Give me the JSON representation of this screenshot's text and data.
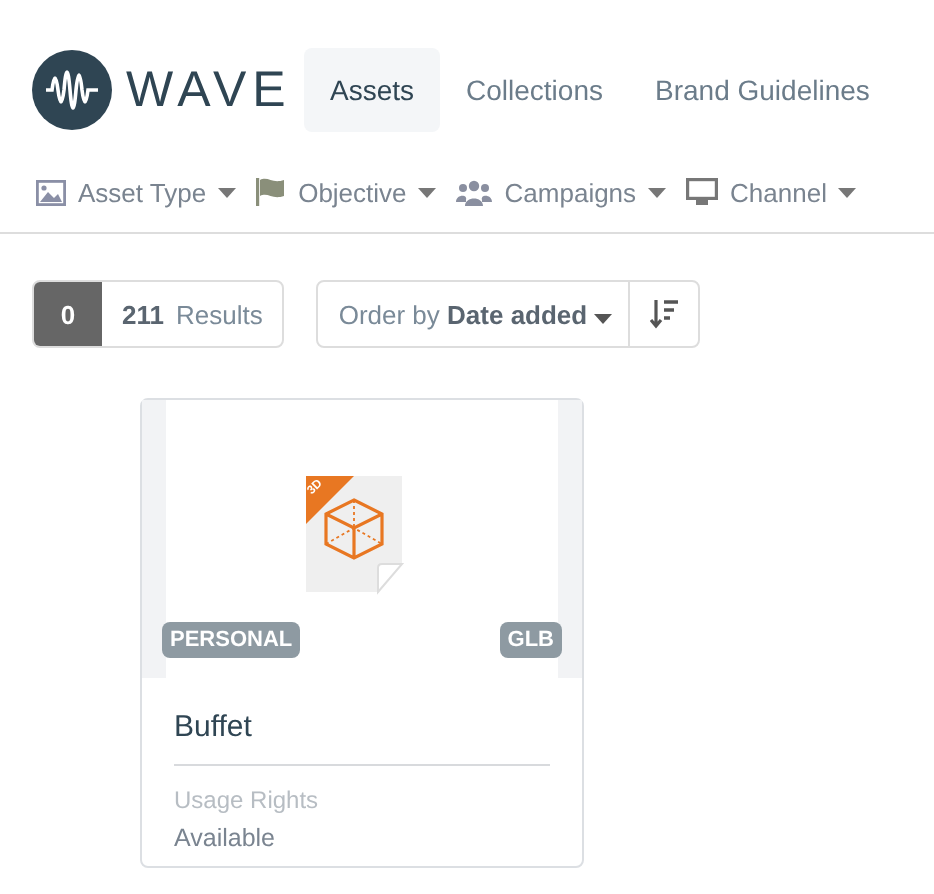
{
  "brand": {
    "name": "WAVE"
  },
  "tabs": [
    {
      "label": "Assets",
      "selected": true
    },
    {
      "label": "Collections",
      "selected": false
    },
    {
      "label": "Brand Guidelines",
      "selected": false
    }
  ],
  "filters": [
    {
      "kind": "image",
      "label": "Asset Type"
    },
    {
      "kind": "flag",
      "label": "Objective"
    },
    {
      "kind": "users",
      "label": "Campaigns"
    },
    {
      "kind": "monitor",
      "label": "Channel"
    }
  ],
  "results": {
    "selected_count": "0",
    "count": "211",
    "label": "Results"
  },
  "sort": {
    "prefix": "Order by",
    "value": "Date added"
  },
  "assets": [
    {
      "title": "Buffet",
      "file_badge": "3D",
      "scope": "PERSONAL",
      "format": "GLB",
      "field_label": "Usage Rights",
      "field_value": "Available"
    }
  ]
}
